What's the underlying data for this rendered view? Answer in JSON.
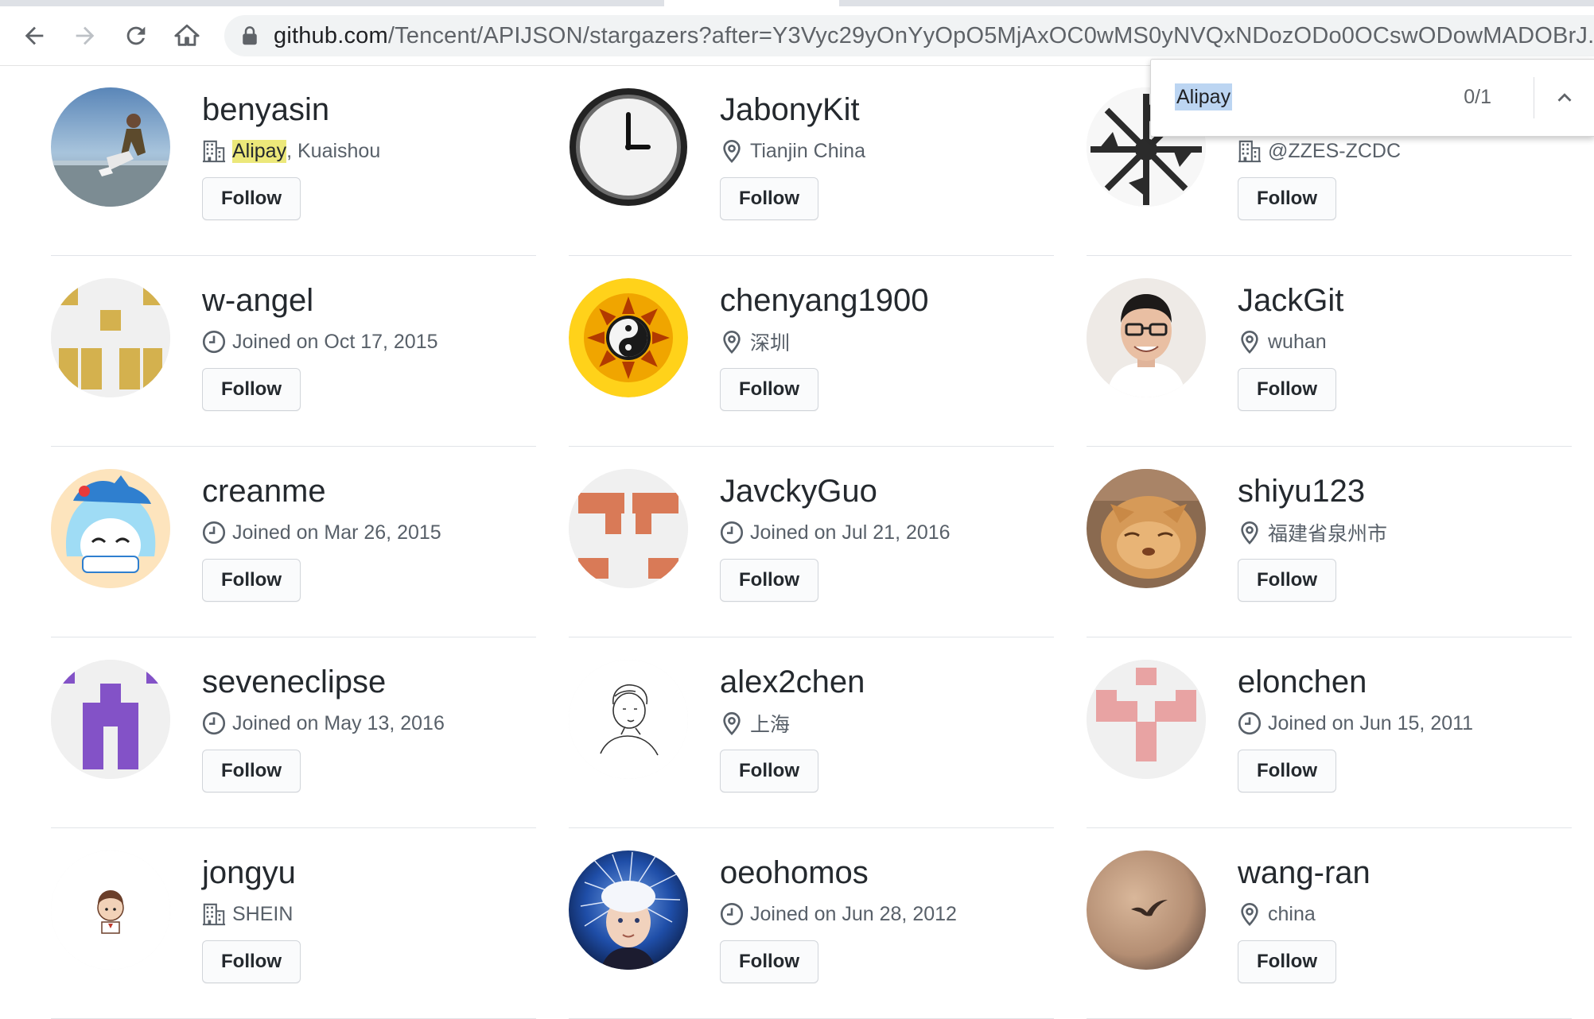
{
  "browser": {
    "url_host": "github.com",
    "url_path": "/Tencent/APIJSON/stargazers?after=Y3Vyc29yOnYyOpO5MjAxOC0wMS0yNVQxNDozODo0OCswODowMADOBrJ..."
  },
  "find": {
    "query": "Alipay",
    "count": "0/1"
  },
  "colors": {
    "highlight": "#ece87a",
    "find_selection": "#bcd5f2",
    "rule": "#e1e4e8"
  },
  "follow_label": "Follow",
  "users": [
    {
      "name": "benyasin",
      "meta_icon": "organization-icon",
      "meta_highlight": "Alipay",
      "meta_text": ", Kuaishou",
      "avatar": "photo-man-by-sea"
    },
    {
      "name": "JabonyKit",
      "meta_icon": "location-icon",
      "meta_text": "Tianjin China",
      "avatar": "clock"
    },
    {
      "name": "",
      "meta_icon": "organization-icon",
      "meta_text": "@ZZES-ZCDC",
      "avatar": "pinwheel"
    },
    {
      "name": "w-angel",
      "meta_icon": "clock-icon",
      "meta_text": "Joined on Oct 17, 2015",
      "avatar": "identicon-gold"
    },
    {
      "name": "chenyang1900",
      "meta_icon": "location-icon",
      "meta_text": "深圳",
      "avatar": "yin-yang-sun"
    },
    {
      "name": "JackGit",
      "meta_icon": "location-icon",
      "meta_text": "wuhan",
      "avatar": "photo-man-glasses"
    },
    {
      "name": "creanme",
      "meta_icon": "clock-icon",
      "meta_text": "Joined on Mar 26, 2015",
      "avatar": "anime-girl"
    },
    {
      "name": "JavckyGuo",
      "meta_icon": "clock-icon",
      "meta_text": "Joined on Jul 21, 2016",
      "avatar": "identicon-orange"
    },
    {
      "name": "shiyu123",
      "meta_icon": "location-icon",
      "meta_text": "福建省泉州市",
      "avatar": "photo-cat"
    },
    {
      "name": "seveneclipse",
      "meta_icon": "clock-icon",
      "meta_text": "Joined on May 13, 2016",
      "avatar": "identicon-purple"
    },
    {
      "name": "alex2chen",
      "meta_icon": "location-icon",
      "meta_text": "上海",
      "avatar": "sketch-boy"
    },
    {
      "name": "elonchen",
      "meta_icon": "clock-icon",
      "meta_text": "Joined on Jun 15, 2011",
      "avatar": "identicon-pink"
    },
    {
      "name": "jongyu",
      "meta_icon": "organization-icon",
      "meta_text": "SHEIN",
      "avatar": "cartoon-boy"
    },
    {
      "name": "oeohomos",
      "meta_icon": "clock-icon",
      "meta_text": "Joined on Jun 28, 2012",
      "avatar": "photo-child-hair"
    },
    {
      "name": "wang-ran",
      "meta_icon": "location-icon",
      "meta_text": "china",
      "avatar": "photo-bird-sky"
    }
  ]
}
